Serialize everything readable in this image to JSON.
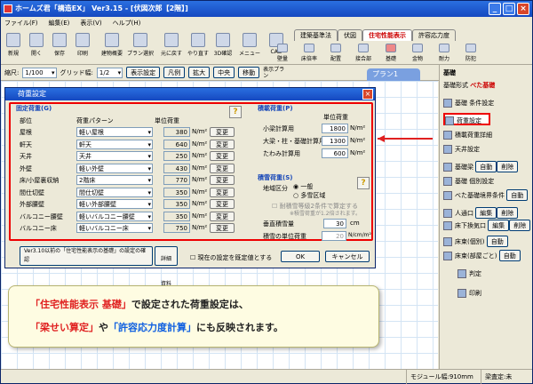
{
  "window": {
    "title": "ホームズ君「構造EX」 Ver3.15 - [伏図次郎【2階】]"
  },
  "menu": [
    "ファイル(F)",
    "編集(E)",
    "表示(V)",
    "ヘルプ(H)"
  ],
  "toolbar": {
    "tools": [
      "新規",
      "開く",
      "保存",
      "印刷",
      "建物概要",
      "プラン選択",
      "元に戻す",
      "やり直す",
      "3D確認",
      "メニュー",
      "CAD",
      "壁量",
      "床倍率",
      "配置",
      "接合部",
      "基礎",
      "金物",
      "耐力",
      "防犯"
    ],
    "tabs": [
      "建築基準法",
      "伏図",
      "住宅性能表示",
      "許容応力度"
    ],
    "active_tab": "住宅性能表示"
  },
  "options": {
    "scale_label": "縮尺:",
    "scale": "1/100",
    "grid_label": "グリッド幅:",
    "grid": "1/2",
    "display_setting": "表示設定",
    "legend": "凡例",
    "zoom": "拡大",
    "center": "中央",
    "move": "移動",
    "display_plan": "表示プラン",
    "plan_tab": "プラン1"
  },
  "right_panel": {
    "title": "基礎",
    "type_label": "基礎形式",
    "type_value": "べた基礎",
    "items": [
      {
        "label": "基礎 条件設定"
      },
      {
        "label": "荷重設定"
      },
      {
        "label": "積載荷重詳細"
      },
      {
        "label": "天井設定"
      },
      {
        "label": "基礎梁",
        "sub": "自動",
        "del": "削除"
      },
      {
        "label": "基礎 個別設定"
      },
      {
        "label": "べた基礎境界条件",
        "sub": "自動",
        "del": "削除"
      },
      {
        "label": "人通口",
        "sub": "編集",
        "del": "削除"
      },
      {
        "label": "床下換気口",
        "sub": "編集",
        "del": "削除"
      },
      {
        "label": "床束(個別)",
        "sub": "自動",
        "del": "削除"
      },
      {
        "label": "床束(部屋ごと)",
        "sub": "自動",
        "del": "削除"
      },
      {
        "label": "判定"
      },
      {
        "label": "印刷"
      }
    ]
  },
  "dialog": {
    "title": "荷重設定",
    "fixed": {
      "title": "固定荷重(G)",
      "col_part": "部位",
      "col_pattern": "荷重パターン",
      "col_unit": "単位荷重",
      "rows": [
        {
          "part": "屋根",
          "pattern": "軽い屋根",
          "value": "380",
          "unit": "N/m²",
          "btn": "変更"
        },
        {
          "part": "軒天",
          "pattern": "軒天",
          "value": "640",
          "unit": "N/m²",
          "btn": "変更"
        },
        {
          "part": "天井",
          "pattern": "天井",
          "value": "250",
          "unit": "N/m²",
          "btn": "変更"
        },
        {
          "part": "外壁",
          "pattern": "軽い外壁",
          "value": "430",
          "unit": "N/m²",
          "btn": "変更"
        },
        {
          "part": "床/小屋裏収納",
          "pattern": "2階床",
          "value": "770",
          "unit": "N/m²",
          "btn": "変更"
        },
        {
          "part": "間仕切壁",
          "pattern": "間仕切壁",
          "value": "350",
          "unit": "N/m²",
          "btn": "変更"
        },
        {
          "part": "外部腰壁",
          "pattern": "軽い外部腰壁",
          "value": "350",
          "unit": "N/m²",
          "btn": "変更"
        },
        {
          "part": "バルコニー腰壁",
          "pattern": "軽いバルコニー腰壁",
          "value": "350",
          "unit": "N/m²",
          "btn": "変更"
        },
        {
          "part": "バルコニー床",
          "pattern": "軽いバルコニー床",
          "value": "750",
          "unit": "N/m²",
          "btn": "変更"
        }
      ]
    },
    "live": {
      "title": "積載荷重(P)",
      "col_unit": "単位荷重",
      "rows": [
        {
          "label": "小梁計算用",
          "value": "1800",
          "unit": "N/m²"
        },
        {
          "label": "大梁・柱・基礎計算用",
          "value": "1300",
          "unit": "N/m²"
        },
        {
          "label": "たわみ計算用",
          "value": "600",
          "unit": "N/m²"
        }
      ]
    },
    "snow": {
      "title": "積雪荷重(S)",
      "region_label": "地域区分",
      "opt1": "一般",
      "opt2": "多雪区域",
      "note1": "耐積雪等級2条件で算定する",
      "note2": "※積雪荷重が1.2倍されます。",
      "depth_label": "垂直積雪量",
      "depth": "30",
      "depth_unit": "cm",
      "unit_label": "積雪の単位荷重",
      "unit_value": "20",
      "unit_unit": "N/cm/m²"
    },
    "compat_btn": "Ver3.10以前の「住宅性能表示の基礎」の設定の確認",
    "detail_btn": "詳細資料",
    "default_check": "現在の設定を既定値とする",
    "ok": "OK",
    "cancel": "キャンセル"
  },
  "callout": {
    "l1a": "「住宅性能表示 基礎」",
    "l1b": "で設定された荷重設定は、",
    "l2a": "「梁せい算定」",
    "l2b": "や",
    "l2c": "「許容応力度計算」",
    "l2d": "にも反映されます。"
  },
  "status": {
    "module": "モジュール幅:910mm",
    "check": "梁査定:未"
  },
  "colors": {
    "accent": "#e02020",
    "title": "#1548c0",
    "highlight": "#1060e0"
  }
}
